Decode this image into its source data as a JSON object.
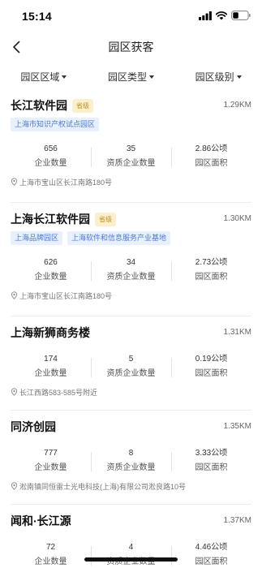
{
  "status_bar": {
    "time": "15:14"
  },
  "header": {
    "title": "园区获客"
  },
  "filters": [
    {
      "label": "园区区域"
    },
    {
      "label": "园区类型"
    },
    {
      "label": "园区级别"
    }
  ],
  "parks": [
    {
      "name": "长江软件园",
      "badge": "省级",
      "distance": "1.29KM",
      "tags": [
        "上海市知识产权试点园区"
      ],
      "stats": [
        {
          "value": "656",
          "label": "企业数量"
        },
        {
          "value": "35",
          "label": "资质企业数量"
        },
        {
          "value": "2.86公顷",
          "label": "园区面积"
        }
      ],
      "address": "上海市宝山区长江南路180号"
    },
    {
      "name": "上海长江软件园",
      "badge": "省级",
      "distance": "1.30KM",
      "tags": [
        "上海品牌园区",
        "上海软件和信息服务产业基地"
      ],
      "stats": [
        {
          "value": "626",
          "label": "企业数量"
        },
        {
          "value": "34",
          "label": "资质企业数量"
        },
        {
          "value": "2.73公顷",
          "label": "园区面积"
        }
      ],
      "address": "上海市宝山区长江南路180号"
    },
    {
      "name": "上海新狮商务楼",
      "distance": "1.31KM",
      "stats": [
        {
          "value": "174",
          "label": "企业数量"
        },
        {
          "value": "5",
          "label": "资质企业数量"
        },
        {
          "value": "0.19公顷",
          "label": "园区面积"
        }
      ],
      "address": "长江西路583-585号附近"
    },
    {
      "name": "同济创园",
      "distance": "1.35KM",
      "stats": [
        {
          "value": "777",
          "label": "企业数量"
        },
        {
          "value": "8",
          "label": "资质企业数量"
        },
        {
          "value": "3.33公顷",
          "label": "园区面积"
        }
      ],
      "address": "淞南镇同恒雷士光电科技(上海)有限公司淞良路10号"
    },
    {
      "name": "闻和·长江源",
      "distance": "1.37KM",
      "stats": [
        {
          "value": "72",
          "label": "企业数量"
        },
        {
          "value": "4",
          "label": "资质企业数量"
        },
        {
          "value": "4.46公顷",
          "label": "园区面积"
        }
      ]
    }
  ]
}
